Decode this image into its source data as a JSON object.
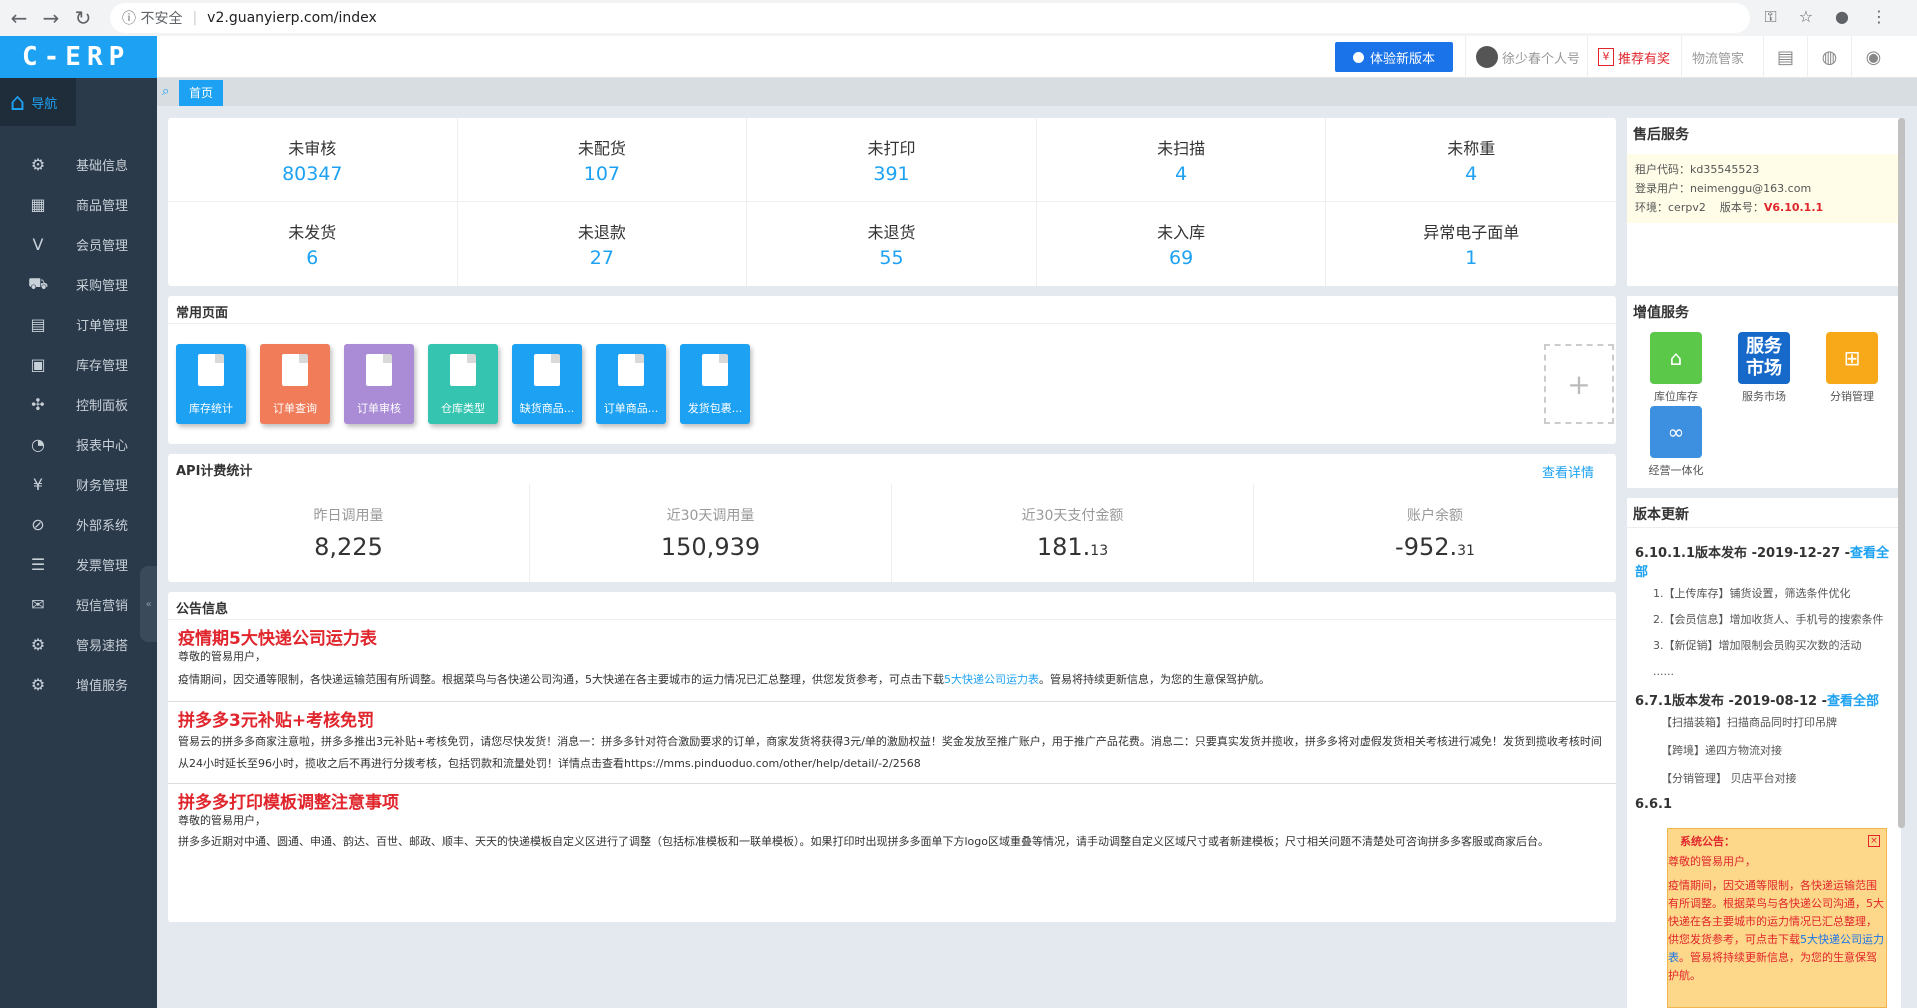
{
  "browser": {
    "security": "不安全",
    "url": "v2.guanyierp.com/index"
  },
  "app": {
    "logo": "C-ERP",
    "trial_button": "体验新版本",
    "user": "徐少春个人号",
    "referral": "推荐有奖",
    "logistics": "物流管家"
  },
  "sidebar": {
    "nav_label": "导航",
    "items": [
      {
        "label": "基础信息",
        "icon": "gear-icon"
      },
      {
        "label": "商品管理",
        "icon": "store-icon"
      },
      {
        "label": "会员管理",
        "icon": "member-icon"
      },
      {
        "label": "采购管理",
        "icon": "cart-icon"
      },
      {
        "label": "订单管理",
        "icon": "clipboard-icon"
      },
      {
        "label": "库存管理",
        "icon": "box-icon"
      },
      {
        "label": "控制面板",
        "icon": "grid-icon"
      },
      {
        "label": "报表中心",
        "icon": "pie-icon"
      },
      {
        "label": "财务管理",
        "icon": "yen-icon"
      },
      {
        "label": "外部系统",
        "icon": "link-icon"
      },
      {
        "label": "发票管理",
        "icon": "invoice-icon"
      },
      {
        "label": "短信营销",
        "icon": "mail-icon"
      },
      {
        "label": "管易速搭",
        "icon": "gear-icon"
      },
      {
        "label": "增值服务",
        "icon": "gear-icon"
      }
    ]
  },
  "tabs": {
    "active": "首页"
  },
  "status": [
    {
      "label": "未审核",
      "value": "80347"
    },
    {
      "label": "未配货",
      "value": "107"
    },
    {
      "label": "未打印",
      "value": "391"
    },
    {
      "label": "未扫描",
      "value": "4"
    },
    {
      "label": "未称重",
      "value": "4"
    },
    {
      "label": "未发货",
      "value": "6"
    },
    {
      "label": "未退款",
      "value": "27"
    },
    {
      "label": "未退货",
      "value": "55"
    },
    {
      "label": "未入库",
      "value": "69"
    },
    {
      "label": "异常电子面单",
      "value": "1"
    }
  ],
  "common_pages": {
    "title": "常用页面",
    "items": [
      {
        "label": "库存统计",
        "color": "#1da1f2"
      },
      {
        "label": "订单查询",
        "color": "#f07c5a"
      },
      {
        "label": "订单审核",
        "color": "#a98bd6"
      },
      {
        "label": "仓库类型",
        "color": "#35c4b0"
      },
      {
        "label": "缺货商品...",
        "color": "#1da1f2"
      },
      {
        "label": "订单商品...",
        "color": "#1da1f2"
      },
      {
        "label": "发货包裹...",
        "color": "#1da1f2"
      }
    ]
  },
  "api": {
    "title": "API计费统计",
    "link": "查看详情",
    "stats": [
      {
        "label": "昨日调用量",
        "value": "8,225",
        "decimal": ""
      },
      {
        "label": "近30天调用量",
        "value": "150,939",
        "decimal": ""
      },
      {
        "label": "近30天支付金额",
        "value": "181.",
        "decimal": "13"
      },
      {
        "label": "账户余额",
        "value": "-952.",
        "decimal": "31"
      }
    ]
  },
  "notices": {
    "title": "公告信息",
    "items": [
      {
        "headline": "疫情期5大快递公司运力表",
        "greeting": "尊敬的管易用户，",
        "body_a": "疫情期间，因交通等限制，各快递运输范围有所调整。根据菜鸟与各快递公司沟通，5大快递在各主要城市的运力情况已汇总整理，供您发货参考，可点击下载",
        "link": "5大快递公司运力表",
        "body_b": "。管易将持续更新信息，为您的生意保驾护航。"
      },
      {
        "headline": "拼多多3元补贴+考核免罚",
        "body_a": "管易云的拼多多商家注意啦，拼多多推出3元补贴+考核免罚，请您尽快发货！消息一：拼多多针对符合激励要求的订单，商家发货将获得3元/单的激励权益！奖金发放至推广账户，用于推广产品花费。消息二：只要真实发货并揽收，拼多多将对虚假发货相关考核进行减免！发货到揽收考核时间从24小时延长至96小时，揽收之后不再进行分拨考核，包括罚款和流量处罚！详情点击查看https://mms.pinduoduo.com/other/help/detail/-2/2568"
      },
      {
        "headline": "拼多多打印模板调整注意事项",
        "greeting": "尊敬的管易用户，",
        "body_a": "拼多多近期对中通、圆通、申通、韵达、百世、邮政、顺丰、天天的快递模板自定义区进行了调整（包括标准模板和一联单模板）。如果打印时出现拼多多面单下方logo区域重叠等情况，请手动调整自定义区域尺寸或者新建模板；尺寸相关问题不清楚处可咨询拼多多客服或商家后台。"
      }
    ]
  },
  "after_sale": {
    "title": "售后服务",
    "tenant": "租户代码：kd35545523",
    "user": "登录用户：neimenggu@163.com",
    "env": "环境：cerpv2",
    "version_label": "版本号：",
    "version": "V6.10.1.1"
  },
  "vas": {
    "title": "增值服务",
    "items": [
      {
        "label": "库位库存",
        "color": "#5cc84a",
        "icon": "house-icon"
      },
      {
        "label": "服务市场",
        "color": "#1669c9",
        "icon": "market-icon",
        "icon_text": "服务市场"
      },
      {
        "label": "分销管理",
        "color": "#f7a91a",
        "icon": "org-chart-icon"
      },
      {
        "label": "经营一体化",
        "color": "#3d8fe0",
        "icon": "chain-icon"
      }
    ]
  },
  "versions": {
    "title": "版本更新",
    "release1": {
      "head": "6.10.1.1版本发布 -2019-12-27 -",
      "link": "查看全部",
      "lines": [
        "1.【上传库存】铺货设置，筛选条件优化",
        "2.【会员信息】增加收货人、手机号的搜索条件",
        "3.【新促销】增加限制会员购买次数的活动",
        "......"
      ]
    },
    "release2": {
      "head": "6.7.1版本发布 -2019-08-12 -",
      "link": "查看全部",
      "lines": [
        "【扫描装箱】扫描商品同时打印吊牌",
        "【跨境】递四方物流对接",
        "【分销管理】 贝店平台对接"
      ]
    },
    "release3_partial": "6.6.1"
  },
  "system_notice": {
    "title": "系统公告：",
    "greeting": "尊敬的管易用户，",
    "body_a": "疫情期间，因交通等限制，各快递运输范围有所调整。根据菜鸟与各快递公司沟通，5大快递在各主要城市的运力情况已汇总整理，供您发货参考，可点击下载",
    "link": "5大快递公司运力表",
    "body_b": "。管易将持续更新信息，为您的生意保驾护航。"
  }
}
